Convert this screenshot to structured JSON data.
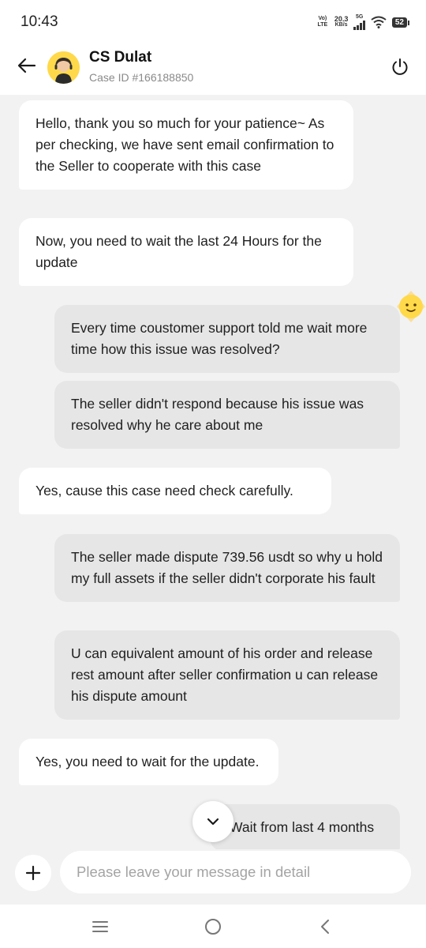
{
  "status_bar": {
    "time": "10:43",
    "volte": "Vo) LTE",
    "speed_value": "20.3",
    "speed_unit": "KB/s",
    "network": "5G",
    "battery": "52"
  },
  "header": {
    "agent_name": "CS Dulat",
    "case_id": "Case ID #166188850"
  },
  "messages": [
    {
      "sender": "agent",
      "text": "Hello, thank you so much for your patience~ As per checking, we have sent email confirmation to the Seller to cooperate with this case"
    },
    {
      "sender": "agent",
      "text": "Now, you need to wait the last 24 Hours for the update"
    },
    {
      "sender": "user",
      "text": "Every time coustomer support told me wait more time how this issue was resolved?"
    },
    {
      "sender": "user",
      "text": "The seller didn't respond because his issue was resolved why he care about me"
    },
    {
      "sender": "agent",
      "text": "Yes, cause this case need check carefully."
    },
    {
      "sender": "user",
      "text": "The seller made dispute 739.56 usdt so why u hold my full assets if the seller didn't corporate his fault"
    },
    {
      "sender": "user",
      "text": "U can equivalent amount of his order and release rest amount after seller confirmation u can release his dispute amount"
    },
    {
      "sender": "agent",
      "text": "Yes, you need to wait for the update."
    },
    {
      "sender": "user",
      "text": "Wait from last 4 months"
    }
  ],
  "composer": {
    "placeholder": "Please leave your message in detail"
  },
  "colors": {
    "background": "#f2f2f2",
    "agent_bubble": "#ffffff",
    "user_bubble": "#e6e6e6",
    "avatar": "#ffd94a"
  },
  "icons": [
    "back-arrow-icon",
    "agent-avatar",
    "power-icon",
    "mascot-icon",
    "chevron-down-icon",
    "plus-icon",
    "menu-icon",
    "home-icon",
    "back-icon"
  ]
}
